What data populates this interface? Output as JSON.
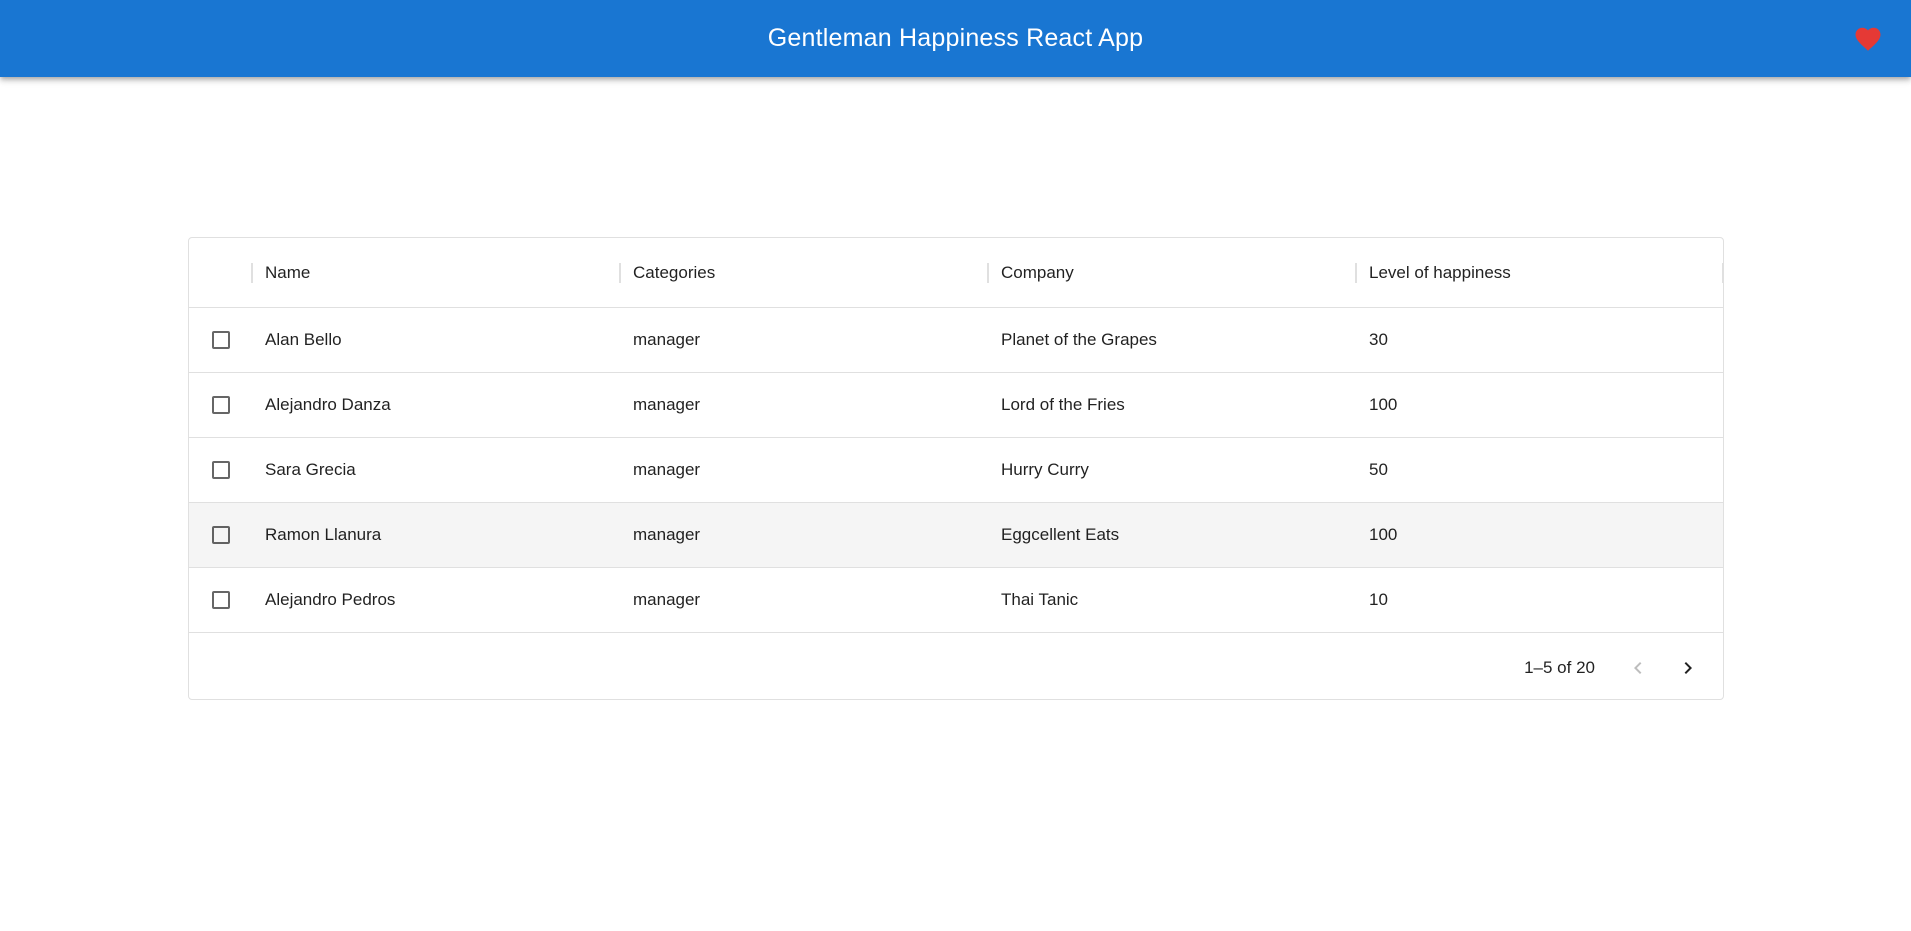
{
  "app": {
    "title": "Gentleman Happiness React App",
    "favorite_icon": "heart-icon",
    "favorite_color": "#e53935",
    "bar_color": "#1976d2"
  },
  "table": {
    "columns": [
      {
        "label": "Name"
      },
      {
        "label": "Categories"
      },
      {
        "label": "Company"
      },
      {
        "label": "Level of happiness"
      }
    ],
    "rows": [
      {
        "name": "Alan Bello",
        "category": "manager",
        "company": "Planet of the Grapes",
        "happiness": "30",
        "checked": false
      },
      {
        "name": "Alejandro Danza",
        "category": "manager",
        "company": "Lord of the Fries",
        "happiness": "100",
        "checked": false
      },
      {
        "name": "Sara Grecia",
        "category": "manager",
        "company": "Hurry Curry",
        "happiness": "50",
        "checked": false
      },
      {
        "name": "Ramon Llanura",
        "category": "manager",
        "company": "Eggcellent Eats",
        "happiness": "100",
        "checked": false,
        "hovered": true
      },
      {
        "name": "Alejandro Pedros",
        "category": "manager",
        "company": "Thai Tanic",
        "happiness": "10",
        "checked": false
      }
    ],
    "pagination": {
      "range_label": "1–5 of 20",
      "prev_icon": "chevron-left-icon",
      "next_icon": "chevron-right-icon"
    }
  }
}
